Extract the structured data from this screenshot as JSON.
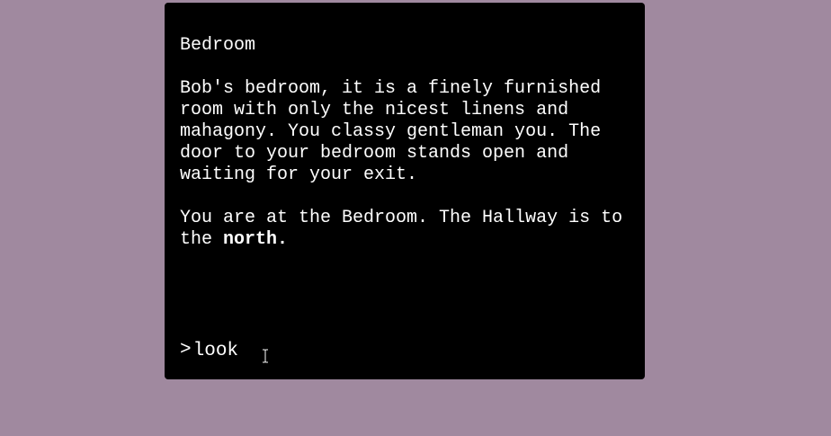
{
  "room": {
    "title": "Bedroom",
    "description": "Bob's bedroom, it is a finely furnished room with only the nicest linens and mahagony. You classy gentleman you. The door to your bedroom stands open and waiting for your exit.",
    "exits_prefix": "You are at the Bedroom. The Hallway is to the ",
    "exits_direction": "north."
  },
  "prompt": {
    "symbol": ">",
    "value": "look"
  },
  "colors": {
    "background": "#a0899f",
    "terminal": "#000000",
    "text": "#ffffff"
  },
  "icons": {
    "cursor": "text-ibeam-cursor-icon"
  }
}
